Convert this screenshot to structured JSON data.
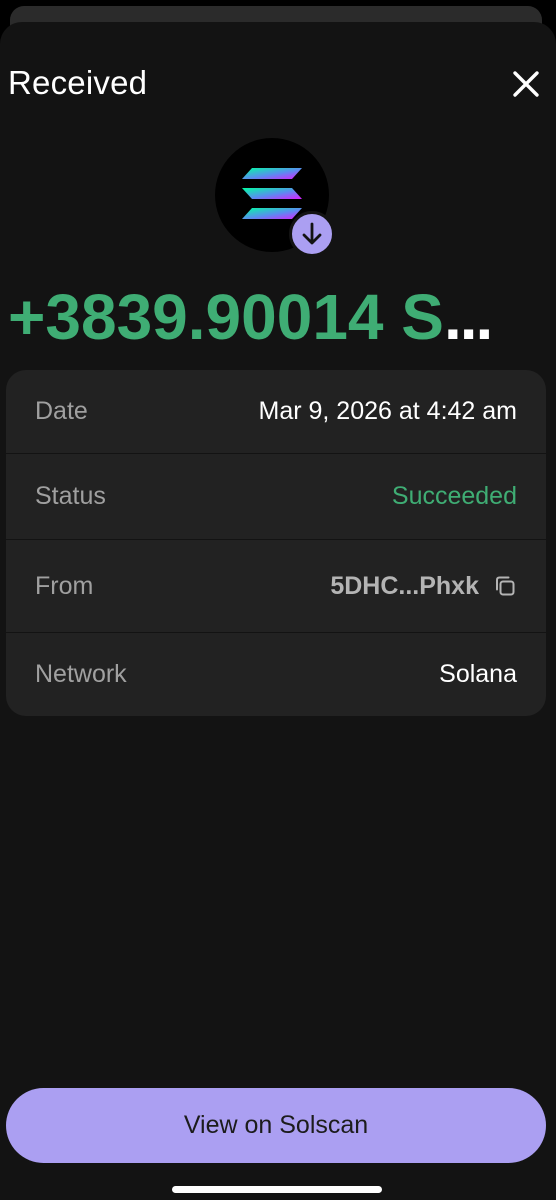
{
  "header": {
    "title": "Received",
    "close_icon": "close-icon"
  },
  "token": {
    "icon": "solana-logo-icon",
    "badge_icon": "arrow-down-icon",
    "amount": "+3839.90014 S",
    "amount_truncation": "..."
  },
  "details": {
    "date": {
      "label": "Date",
      "value": "Mar 9, 2026 at 4:42 am"
    },
    "status": {
      "label": "Status",
      "value": "Succeeded"
    },
    "from": {
      "label": "From",
      "value": "5DHC...Phxk",
      "icon": "copy-icon"
    },
    "network": {
      "label": "Network",
      "value": "Solana"
    }
  },
  "actions": {
    "view_button_label": "View on Solscan"
  },
  "colors": {
    "background": "#131313",
    "card": "#222222",
    "accent": "#ab9ff2",
    "success": "#3fad74",
    "label": "#a0a0a0"
  }
}
